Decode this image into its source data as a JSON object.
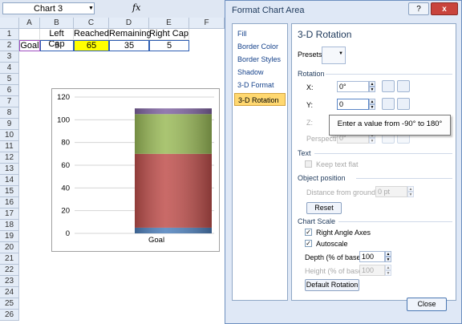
{
  "excel": {
    "namebox": "Chart 3",
    "fx": "fx",
    "columns": [
      "A",
      "B",
      "C",
      "D",
      "E",
      "F"
    ],
    "rows": [
      "1",
      "2",
      "3",
      "4",
      "5",
      "6",
      "7",
      "8",
      "9",
      "10",
      "11",
      "12",
      "13",
      "14",
      "15",
      "16",
      "17",
      "18",
      "19",
      "20",
      "21",
      "22",
      "23",
      "24",
      "25",
      "26"
    ],
    "headers": [
      "Left Cap",
      "Reached",
      "Remaining",
      "Right Cap"
    ],
    "row2": [
      "Goal",
      "5",
      "65",
      "35",
      "5"
    ],
    "highlight_color": "#ffff00"
  },
  "chart_data": {
    "type": "bar",
    "stacked": true,
    "categories": [
      "Goal"
    ],
    "series": [
      {
        "name": "Left Cap",
        "values": [
          5
        ],
        "color": "#4f81bd"
      },
      {
        "name": "Reached",
        "values": [
          65
        ],
        "color": "#c0504d"
      },
      {
        "name": "Remaining",
        "values": [
          35
        ],
        "color": "#9bbb59"
      },
      {
        "name": "Right Cap",
        "values": [
          5
        ],
        "color": "#8064a2"
      }
    ],
    "yticks": [
      "0",
      "20",
      "40",
      "60",
      "80",
      "100",
      "120"
    ],
    "ylim": [
      0,
      120
    ],
    "xlabel": "Goal"
  },
  "dialog": {
    "title": "Format Chart Area",
    "help": "?",
    "close_x": "x",
    "nav": [
      "Fill",
      "Border Color",
      "Border Styles",
      "Shadow",
      "3-D Format",
      "3-D Rotation"
    ],
    "panel_title": "3-D Rotation",
    "presets_label": "Presets:",
    "rotation_section": "Rotation",
    "x_label": "X:",
    "x_value": "0°",
    "y_label": "Y:",
    "y_value": "0",
    "z_label": "Z:",
    "perspective_label": "Perspective:",
    "perspective_value": "0°",
    "tooltip": "Enter a value from -90° to 180°",
    "text_section": "Text",
    "keep_text_flat": "Keep text flat",
    "object_section": "Object position",
    "distance_label": "Distance from ground:",
    "distance_value": "0 pt",
    "reset_label": "Reset",
    "scale_section": "Chart Scale",
    "right_angle": "Right Angle Axes",
    "autoscale": "Autoscale",
    "depth_label": "Depth (% of base)",
    "depth_value": "100",
    "height_label": "Height (% of base)",
    "height_value": "100",
    "default_rotation": "Default Rotation",
    "close_button": "Close"
  }
}
